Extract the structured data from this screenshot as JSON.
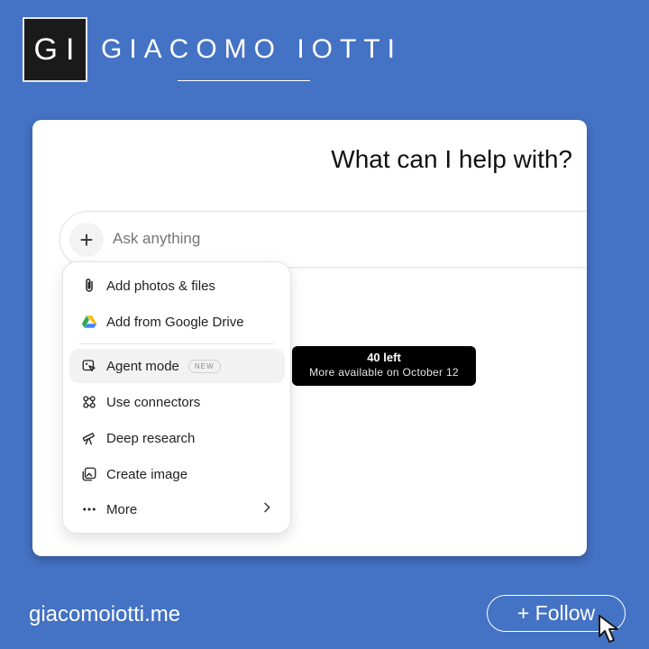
{
  "brand": {
    "logo_text": "GI",
    "name": "GIACOMO IOTTI"
  },
  "card": {
    "title": "What can I help with?",
    "composer": {
      "plus": "+",
      "placeholder": "Ask anything"
    },
    "menu": {
      "items": [
        {
          "label": "Add photos & files",
          "icon": "paperclip-icon"
        },
        {
          "label": "Add from Google Drive",
          "icon": "google-drive-icon"
        },
        {
          "label": "Agent mode",
          "icon": "agent-icon",
          "badge": "NEW",
          "active": true
        },
        {
          "label": "Use connectors",
          "icon": "connectors-icon"
        },
        {
          "label": "Deep research",
          "icon": "telescope-icon"
        },
        {
          "label": "Create image",
          "icon": "image-icon"
        },
        {
          "label": "More",
          "icon": "dots-icon",
          "chevron": "chevron-right-icon"
        }
      ]
    },
    "tooltip": {
      "line1": "40 left",
      "line2": "More available on October 12"
    }
  },
  "footer": {
    "website": "giacomoiotti.me",
    "follow_label": "+ Follow"
  },
  "colors": {
    "background": "#4472c4",
    "card": "#ffffff",
    "tooltip": "#000000"
  }
}
